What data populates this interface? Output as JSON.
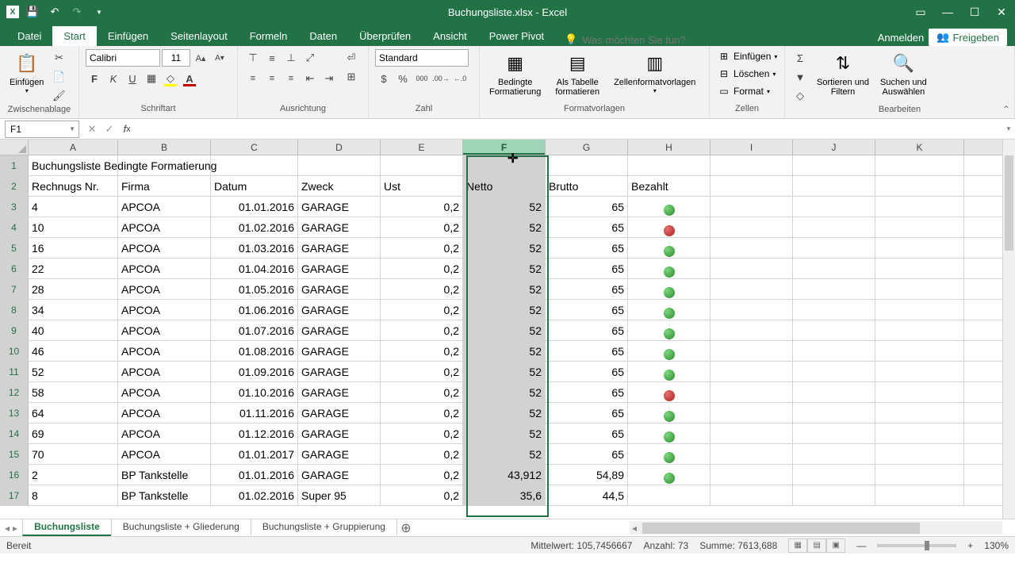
{
  "app": {
    "title": "Buchungsliste.xlsx - Excel",
    "sign_in": "Anmelden",
    "share": "Freigeben"
  },
  "tabs": {
    "file": "Datei",
    "home": "Start",
    "insert": "Einfügen",
    "page": "Seitenlayout",
    "formulas": "Formeln",
    "data": "Daten",
    "review": "Überprüfen",
    "view": "Ansicht",
    "powerpivot": "Power Pivot",
    "tellme_placeholder": "Was möchten Sie tun?"
  },
  "ribbon": {
    "clipboard": {
      "label": "Zwischenablage",
      "paste": "Einfügen"
    },
    "font": {
      "label": "Schriftart",
      "name": "Calibri",
      "size": "11"
    },
    "alignment": {
      "label": "Ausrichtung"
    },
    "number": {
      "label": "Zahl",
      "format": "Standard"
    },
    "styles": {
      "label": "Formatvorlagen",
      "conditional": "Bedingte\nFormatierung",
      "table": "Als Tabelle\nformatieren",
      "cellstyles": "Zellenformatvorlagen"
    },
    "cells": {
      "label": "Zellen",
      "insert": "Einfügen",
      "delete": "Löschen",
      "format": "Format"
    },
    "editing": {
      "label": "Bearbeiten",
      "sort": "Sortieren und\nFiltern",
      "find": "Suchen und\nAuswählen"
    }
  },
  "namebox": "F1",
  "formula": "",
  "columns": [
    "A",
    "B",
    "C",
    "D",
    "E",
    "F",
    "G",
    "H",
    "I",
    "J",
    "K"
  ],
  "selected_column": "F",
  "row_headers": [
    1,
    2,
    3,
    4,
    5,
    6,
    7,
    8,
    9,
    10,
    11,
    12,
    13,
    14,
    15,
    16,
    17
  ],
  "sheet": {
    "title_row": "Buchungsliste Bedingte Formatierung",
    "headers": {
      "a": "Rechnugs Nr.",
      "b": "Firma",
      "c": "Datum",
      "d": "Zweck",
      "e": "Ust",
      "f": "Netto",
      "g": "Brutto",
      "h": "Bezahlt"
    },
    "rows": [
      {
        "a": "4",
        "b": "APCOA",
        "c": "01.01.2016",
        "d": "GARAGE",
        "e": "0,2",
        "f": "52",
        "g": "65",
        "h": "green"
      },
      {
        "a": "10",
        "b": "APCOA",
        "c": "01.02.2016",
        "d": "GARAGE",
        "e": "0,2",
        "f": "52",
        "g": "65",
        "h": "red"
      },
      {
        "a": "16",
        "b": "APCOA",
        "c": "01.03.2016",
        "d": "GARAGE",
        "e": "0,2",
        "f": "52",
        "g": "65",
        "h": "green"
      },
      {
        "a": "22",
        "b": "APCOA",
        "c": "01.04.2016",
        "d": "GARAGE",
        "e": "0,2",
        "f": "52",
        "g": "65",
        "h": "green"
      },
      {
        "a": "28",
        "b": "APCOA",
        "c": "01.05.2016",
        "d": "GARAGE",
        "e": "0,2",
        "f": "52",
        "g": "65",
        "h": "green"
      },
      {
        "a": "34",
        "b": "APCOA",
        "c": "01.06.2016",
        "d": "GARAGE",
        "e": "0,2",
        "f": "52",
        "g": "65",
        "h": "green"
      },
      {
        "a": "40",
        "b": "APCOA",
        "c": "01.07.2016",
        "d": "GARAGE",
        "e": "0,2",
        "f": "52",
        "g": "65",
        "h": "green"
      },
      {
        "a": "46",
        "b": "APCOA",
        "c": "01.08.2016",
        "d": "GARAGE",
        "e": "0,2",
        "f": "52",
        "g": "65",
        "h": "green"
      },
      {
        "a": "52",
        "b": "APCOA",
        "c": "01.09.2016",
        "d": "GARAGE",
        "e": "0,2",
        "f": "52",
        "g": "65",
        "h": "green"
      },
      {
        "a": "58",
        "b": "APCOA",
        "c": "01.10.2016",
        "d": "GARAGE",
        "e": "0,2",
        "f": "52",
        "g": "65",
        "h": "red"
      },
      {
        "a": "64",
        "b": "APCOA",
        "c": "01.11.2016",
        "d": "GARAGE",
        "e": "0,2",
        "f": "52",
        "g": "65",
        "h": "green"
      },
      {
        "a": "69",
        "b": "APCOA",
        "c": "01.12.2016",
        "d": "GARAGE",
        "e": "0,2",
        "f": "52",
        "g": "65",
        "h": "green"
      },
      {
        "a": "70",
        "b": "APCOA",
        "c": "01.01.2017",
        "d": "GARAGE",
        "e": "0,2",
        "f": "52",
        "g": "65",
        "h": "green"
      },
      {
        "a": "2",
        "b": "BP Tankstelle",
        "c": "01.01.2016",
        "d": "GARAGE",
        "e": "0,2",
        "f": "43,912",
        "g": "54,89",
        "h": "green"
      },
      {
        "a": "8",
        "b": "BP Tankstelle",
        "c": "01.02.2016",
        "d": "Super 95",
        "e": "0,2",
        "f": "35,6",
        "g": "44,5",
        "h": ""
      }
    ]
  },
  "sheets": {
    "active": "Buchungsliste",
    "tab1": "Buchungsliste",
    "tab2": "Buchungsliste + Gliederung",
    "tab3": "Buchungsliste + Gruppierung"
  },
  "status": {
    "ready": "Bereit",
    "avg_label": "Mittelwert:",
    "avg": "105,7456667",
    "count_label": "Anzahl:",
    "count": "73",
    "sum_label": "Summe:",
    "sum": "7613,688",
    "zoom": "130%"
  }
}
